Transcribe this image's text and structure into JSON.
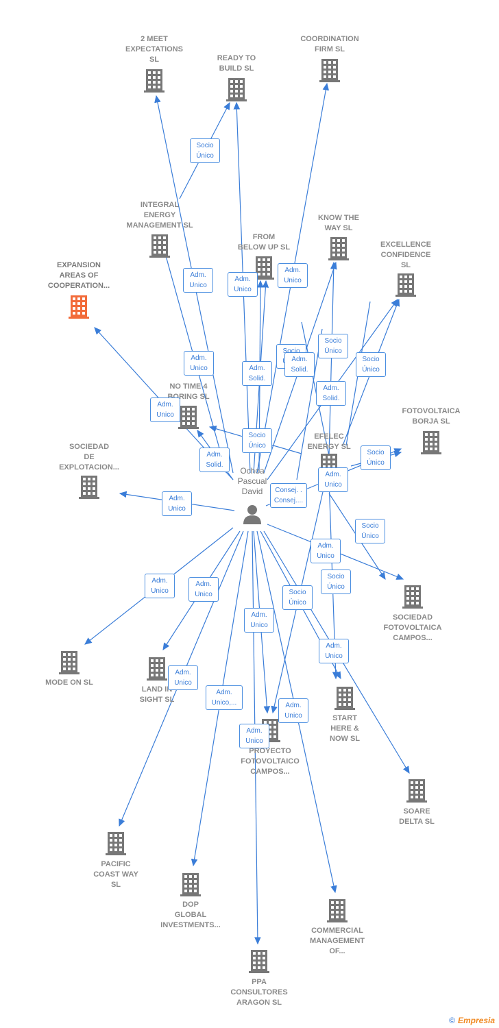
{
  "colors": {
    "edge": "#3a7dd8",
    "building": "#777777",
    "highlight": "#f26b3a",
    "label": "#8a8a8a"
  },
  "person": {
    "name": "Ochoa\nPascual\nDavid",
    "icon": "person-icon"
  },
  "nodes": [
    {
      "id": "2meet",
      "label": "2 MEET\nEXPECTATIONS\nSL"
    },
    {
      "id": "ready",
      "label": "READY TO\nBUILD  SL"
    },
    {
      "id": "coord",
      "label": "COORDINATION\nFIRM  SL"
    },
    {
      "id": "integral",
      "label": "INTEGRAL\nENERGY\nMANAGEMENT SL"
    },
    {
      "id": "below",
      "label": "FROM\nBELOW UP  SL"
    },
    {
      "id": "know",
      "label": "KNOW THE\nWAY  SL"
    },
    {
      "id": "excel",
      "label": "EXCELLENCE\nCONFIDENCE\nSL"
    },
    {
      "id": "expansion",
      "label": "EXPANSION\nAREAS OF\nCOOPERATION...",
      "highlighted": true
    },
    {
      "id": "notime",
      "label": "NO TIME 4\nBORING  SL"
    },
    {
      "id": "borja",
      "label": "FOTOVOLTAICA\nBORJA  SL"
    },
    {
      "id": "explot",
      "label": "SOCIEDAD\nDE\nEXPLOTACION..."
    },
    {
      "id": "efelec",
      "label": "EFELEC\nENERGY  SL"
    },
    {
      "id": "sfc",
      "label": "SOCIEDAD\nFOTOVOLTAICA\nCAMPOS..."
    },
    {
      "id": "mode",
      "label": "MODE ON  SL"
    },
    {
      "id": "land",
      "label": "LAND IN\nSIGHT  SL"
    },
    {
      "id": "start",
      "label": "START\nHERE &\nNOW  SL"
    },
    {
      "id": "proyecto",
      "label": "PROYECTO\nFOTOVOLTAICO\nCAMPOS..."
    },
    {
      "id": "soare",
      "label": "SOARE\nDELTA SL"
    },
    {
      "id": "pacific",
      "label": "PACIFIC\nCOAST WAY\nSL"
    },
    {
      "id": "dop",
      "label": "DOP\nGLOBAL\nINVESTMENTS..."
    },
    {
      "id": "commercial",
      "label": "COMMERCIAL\nMANAGEMENT\nOF..."
    },
    {
      "id": "ppa",
      "label": "PPA\nCONSULTORES\nARAGON  SL"
    }
  ],
  "edge_labels": [
    "Socio\nÚnico",
    "Adm.\nUnico",
    "Adm.\nUnico",
    "Adm.\nUnico",
    "Adm.\nUnico",
    "Adm.\nSolid.",
    "Socio\nÚnico",
    "Adm.\nSolid.",
    "Socio\nÚnico",
    "Socio\nÚnico",
    "Adm.\nSolid.",
    "Adm.\nUnico",
    "Socio\nÚnico",
    "Adm.\nSolid.",
    "Socio\nÚnico",
    "Adm.\nUnico",
    "Consej. .\nConsej....",
    "Adm.\nUnico",
    "Socio\nÚnico",
    "Adm.\nUnico",
    "Socio\nÚnico",
    "Adm.\nUnico",
    "Adm.\nUnico",
    "Socio\nÚnico",
    "Adm.\nUnico",
    "Adm.\nUnico",
    "Adm.\nUnico",
    "Adm.\nUnico,...",
    "Adm.\nUnico",
    "Adm.\nUnico"
  ],
  "footer": {
    "copyright": "©",
    "brand": "Empresia"
  }
}
